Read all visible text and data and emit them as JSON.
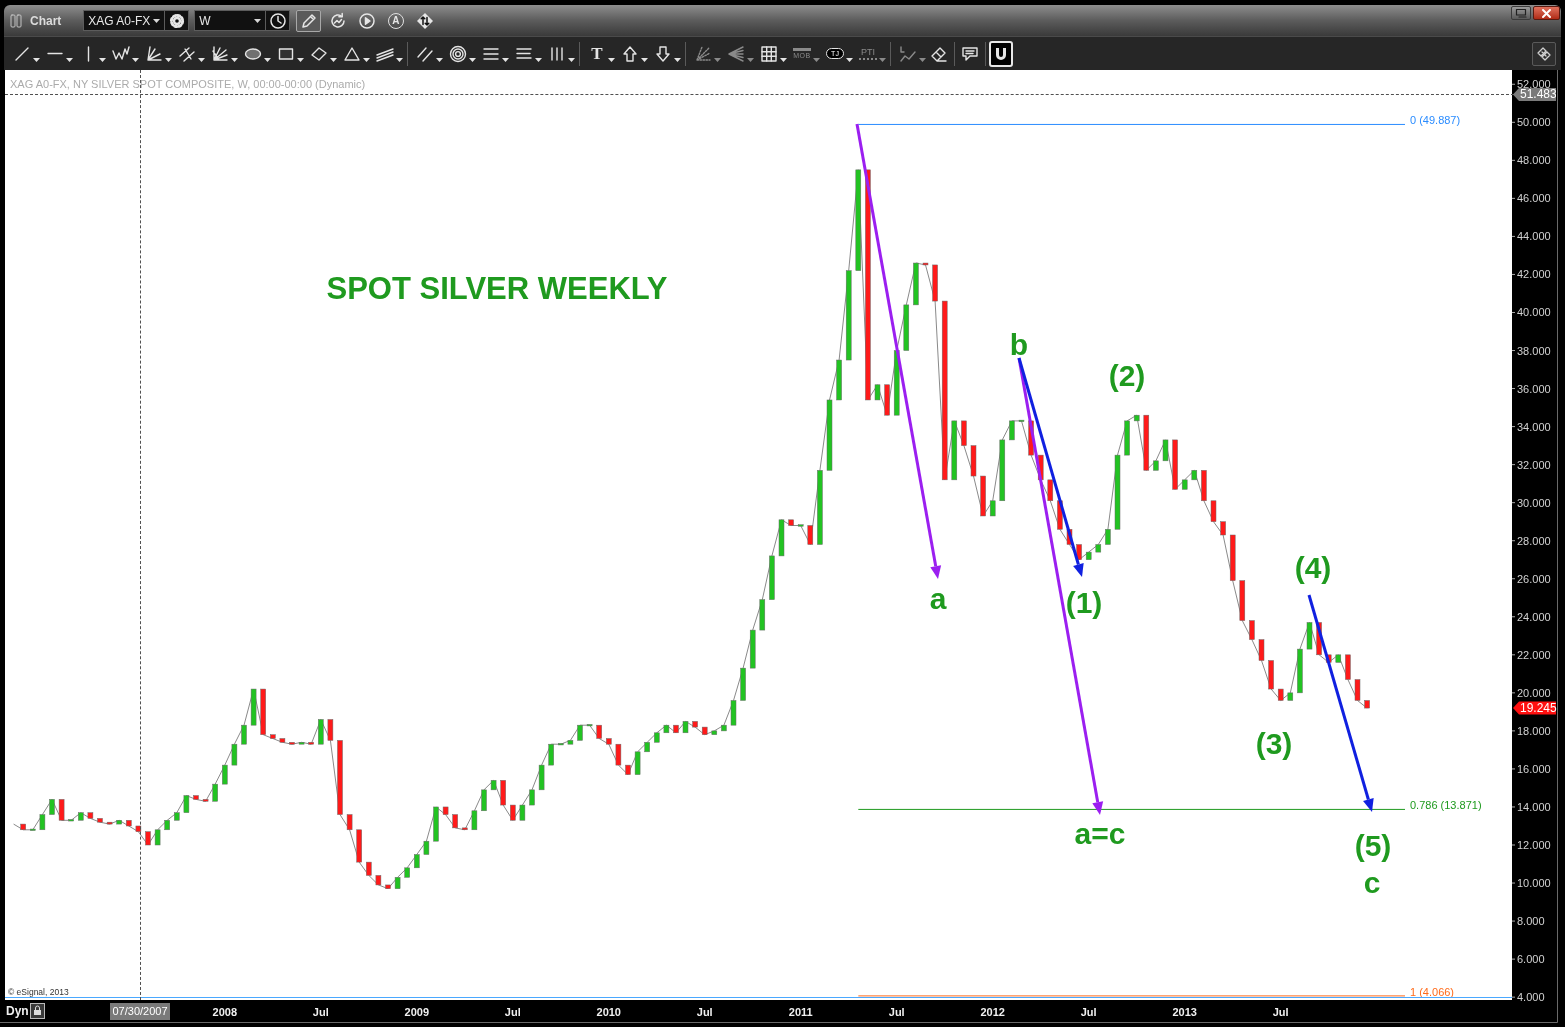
{
  "window": {
    "title": "Chart"
  },
  "title_bar": {
    "symbol": "XAG A0-FX",
    "interval": "W",
    "buttons": [
      {
        "kind": "pencil",
        "selected": true
      },
      {
        "kind": "refresh",
        "selected": false
      },
      {
        "kind": "play",
        "selected": false
      },
      {
        "kind": "letter",
        "label": "A",
        "selected": false
      },
      {
        "kind": "swap",
        "selected": false
      }
    ]
  },
  "toolbar": {
    "groups": [
      [
        {
          "kind": "line",
          "menu": true,
          "disabled": false,
          "on": false
        },
        {
          "kind": "horizontal_line",
          "menu": true,
          "disabled": false,
          "on": false
        },
        {
          "kind": "vertical_line",
          "menu": true,
          "disabled": false,
          "on": false
        },
        {
          "kind": "zigzag",
          "menu": true,
          "disabled": false,
          "on": false
        },
        {
          "kind": "fan",
          "menu": true,
          "disabled": false,
          "on": false
        },
        {
          "kind": "pitchfork",
          "menu": true,
          "disabled": false,
          "on": false
        },
        {
          "kind": "fan_grid",
          "menu": true,
          "disabled": false,
          "on": false
        },
        {
          "kind": "ellipse",
          "menu": true,
          "disabled": false,
          "on": false
        },
        {
          "kind": "rectangle",
          "menu": true,
          "disabled": false,
          "on": false
        },
        {
          "kind": "rotated_rectangle",
          "menu": true,
          "disabled": false,
          "on": false
        },
        {
          "kind": "triangle",
          "menu": true,
          "disabled": false,
          "on": false
        },
        {
          "kind": "channel",
          "menu": true,
          "disabled": false,
          "on": false
        }
      ],
      [
        {
          "kind": "parallel",
          "menu": true,
          "disabled": false,
          "on": false
        },
        {
          "kind": "circles",
          "menu": true,
          "disabled": false,
          "on": false
        },
        {
          "kind": "levels",
          "menu": true,
          "disabled": false,
          "on": false
        },
        {
          "kind": "levels_alt",
          "menu": true,
          "disabled": false,
          "on": false
        },
        {
          "kind": "cycles",
          "menu": true,
          "disabled": false,
          "on": false
        }
      ],
      [
        {
          "kind": "text",
          "label": "T",
          "menu": true,
          "disabled": false,
          "on": false
        },
        {
          "kind": "arrow_up",
          "menu": true,
          "disabled": false,
          "on": false
        },
        {
          "kind": "arrow_down",
          "menu": true,
          "disabled": false,
          "on": false
        }
      ],
      [
        {
          "kind": "fan_dotted",
          "menu": true,
          "disabled": true,
          "on": false
        },
        {
          "kind": "arrow_fan",
          "menu": true,
          "disabled": true,
          "on": false
        },
        {
          "kind": "grid",
          "menu": true,
          "disabled": false,
          "on": false
        },
        {
          "kind": "bar_label",
          "label": "MOB",
          "menu": true,
          "disabled": true,
          "on": false
        },
        {
          "kind": "oval_label",
          "label": "TJ",
          "menu": true,
          "disabled": false,
          "on": false
        },
        {
          "kind": "dotted_label",
          "label": "PTI",
          "menu": true,
          "disabled": true,
          "on": false
        }
      ],
      [
        {
          "kind": "line_chart",
          "menu": true,
          "disabled": true,
          "on": false
        },
        {
          "kind": "eraser",
          "menu": false,
          "disabled": false,
          "on": false
        }
      ],
      [
        {
          "kind": "comment",
          "menu": false,
          "disabled": false,
          "on": false
        }
      ],
      [
        {
          "kind": "magnet",
          "menu": false,
          "disabled": false,
          "on": true
        }
      ]
    ]
  },
  "chart": {
    "header": "XAG A0-FX, NY SILVER SPOT COMPOSITE, W, 00:00-00:00 (Dynamic)",
    "copyright": "© eSignal, 2013",
    "crosshair": {
      "price": "51.483",
      "date": "07/30/2007"
    },
    "last_price": "19.245",
    "chart_data": {
      "type": "line",
      "title": "SPOT SILVER WEEKLY",
      "xlim": [
        2006.855,
        2014.705
      ],
      "ylim": [
        3.85,
        52.75
      ],
      "xticks": [
        {
          "value": 2008,
          "label": "2008"
        },
        {
          "value": 2008.5,
          "label": "Jul"
        },
        {
          "value": 2009,
          "label": "2009"
        },
        {
          "value": 2009.5,
          "label": "Jul"
        },
        {
          "value": 2010,
          "label": "2010"
        },
        {
          "value": 2010.5,
          "label": "Jul"
        },
        {
          "value": 2011,
          "label": "2011"
        },
        {
          "value": 2011.5,
          "label": "Jul"
        },
        {
          "value": 2012,
          "label": "2012"
        },
        {
          "value": 2012.5,
          "label": "Jul"
        },
        {
          "value": 2013,
          "label": "2013"
        },
        {
          "value": 2013.5,
          "label": "Jul"
        }
      ],
      "yticks": [
        {
          "value": 52,
          "label": "52.000"
        },
        {
          "value": 50,
          "label": "50.000"
        },
        {
          "value": 48,
          "label": "48.000"
        },
        {
          "value": 46,
          "label": "46.000"
        },
        {
          "value": 44,
          "label": "44.000"
        },
        {
          "value": 42,
          "label": "42.000"
        },
        {
          "value": 40,
          "label": "40.000"
        },
        {
          "value": 38,
          "label": "38.000"
        },
        {
          "value": 36,
          "label": "36.000"
        },
        {
          "value": 34,
          "label": "34.000"
        },
        {
          "value": 32,
          "label": "32.000"
        },
        {
          "value": 30,
          "label": "30.000"
        },
        {
          "value": 28,
          "label": "28.000"
        },
        {
          "value": 26,
          "label": "26.000"
        },
        {
          "value": 24,
          "label": "24.000"
        },
        {
          "value": 22,
          "label": "22.000"
        },
        {
          "value": 20,
          "label": "20.000"
        },
        {
          "value": 18,
          "label": "18.000"
        },
        {
          "value": 16,
          "label": "16.000"
        },
        {
          "value": 14,
          "label": "14.000"
        },
        {
          "value": 12,
          "label": "12.000"
        },
        {
          "value": 10,
          "label": "10.000"
        },
        {
          "value": 8,
          "label": "8.000"
        },
        {
          "value": 6,
          "label": "6.000"
        },
        {
          "value": 4,
          "label": "4.000"
        }
      ],
      "x": [
        2006.9,
        2006.95,
        2007,
        2007.05,
        2007.1,
        2007.15,
        2007.2,
        2007.25,
        2007.3,
        2007.35,
        2007.4,
        2007.45,
        2007.5,
        2007.55,
        2007.6,
        2007.65,
        2007.7,
        2007.75,
        2007.8,
        2007.85,
        2007.9,
        2007.95,
        2008,
        2008.05,
        2008.1,
        2008.15,
        2008.2,
        2008.25,
        2008.3,
        2008.35,
        2008.4,
        2008.45,
        2008.5,
        2008.55,
        2008.6,
        2008.65,
        2008.7,
        2008.75,
        2008.8,
        2008.85,
        2008.9,
        2008.95,
        2009,
        2009.05,
        2009.1,
        2009.15,
        2009.2,
        2009.25,
        2009.3,
        2009.35,
        2009.4,
        2009.45,
        2009.5,
        2009.55,
        2009.6,
        2009.65,
        2009.7,
        2009.75,
        2009.8,
        2009.85,
        2009.9,
        2009.95,
        2010,
        2010.05,
        2010.1,
        2010.15,
        2010.2,
        2010.25,
        2010.3,
        2010.35,
        2010.4,
        2010.45,
        2010.5,
        2010.55,
        2010.6,
        2010.65,
        2010.7,
        2010.75,
        2010.8,
        2010.85,
        2010.9,
        2010.95,
        2011,
        2011.05,
        2011.1,
        2011.15,
        2011.2,
        2011.25,
        2011.3,
        2011.35,
        2011.4,
        2011.45,
        2011.5,
        2011.55,
        2011.6,
        2011.65,
        2011.7,
        2011.75,
        2011.8,
        2011.85,
        2011.9,
        2011.95,
        2012,
        2012.05,
        2012.1,
        2012.15,
        2012.2,
        2012.25,
        2012.3,
        2012.35,
        2012.4,
        2012.45,
        2012.5,
        2012.55,
        2012.6,
        2012.65,
        2012.7,
        2012.75,
        2012.8,
        2012.85,
        2012.9,
        2012.95,
        2013,
        2013.05,
        2013.1,
        2013.15,
        2013.2,
        2013.25,
        2013.3,
        2013.35,
        2013.4,
        2013.45,
        2013.5,
        2013.55,
        2013.6,
        2013.65,
        2013.7,
        2013.75,
        2013.8,
        2013.85,
        2013.9,
        2013.95
      ],
      "values": [
        13.1,
        12.8,
        12.8,
        13.6,
        14.4,
        13.3,
        13.3,
        13.7,
        13.4,
        13.2,
        13.1,
        13.3,
        13.0,
        12.7,
        12.0,
        12.8,
        13.3,
        13.7,
        14.6,
        14.4,
        14.3,
        15.2,
        16.2,
        17.3,
        18.3,
        20.2,
        17.8,
        17.6,
        17.4,
        17.3,
        17.4,
        17.3,
        18.6,
        17.5,
        13.6,
        12.8,
        11.1,
        10.4,
        9.9,
        9.7,
        10.3,
        10.8,
        11.5,
        12.2,
        14.0,
        13.6,
        12.9,
        12.8,
        13.8,
        14.9,
        15.4,
        14.1,
        13.3,
        14.1,
        14.9,
        16.2,
        17.3,
        17.3,
        17.5,
        18.3,
        18.3,
        17.6,
        17.3,
        16.2,
        15.7,
        16.9,
        17.4,
        17.9,
        18.3,
        17.9,
        18.5,
        18.2,
        17.8,
        18.0,
        18.3,
        19.6,
        21.3,
        23.3,
        24.9,
        27.2,
        29.1,
        28.8,
        28.8,
        27.8,
        31.7,
        35.4,
        37.5,
        42.2,
        47.5,
        35.4,
        36.2,
        34.6,
        38.0,
        40.4,
        42.6,
        42.5,
        40.6,
        31.2,
        34.3,
        33.0,
        31.4,
        29.3,
        30.1,
        33.3,
        34.3,
        34.3,
        32.5,
        31.2,
        30.1,
        28.6,
        27.8,
        27.0,
        27.4,
        27.8,
        28.6,
        32.5,
        34.3,
        34.6,
        31.7,
        32.2,
        33.3,
        30.7,
        31.2,
        31.7,
        30.1,
        29.0,
        28.3,
        25.9,
        23.8,
        22.8,
        21.7,
        20.2,
        19.6,
        20.0,
        22.3,
        23.7,
        22.0,
        21.6,
        22.0,
        20.7,
        19.6,
        19.2
      ],
      "ref_lines": [
        {
          "axis": "y",
          "value": 49.887,
          "label": "0 (49.887)",
          "color": "#2a8cff"
        },
        {
          "axis": "y",
          "value": 13.871,
          "label": "0.786 (13.871)",
          "color": "#1f9a1f"
        },
        {
          "axis": "y",
          "value": 4.066,
          "label": "1 (4.066)",
          "color": "#ff6a1a"
        }
      ],
      "annotations": [
        "b",
        "(2)",
        "(4)",
        "a",
        "(1)",
        "(3)",
        "a=c",
        "(5)",
        "c"
      ]
    }
  },
  "bottom_bar": {
    "mode": "Dyn"
  }
}
